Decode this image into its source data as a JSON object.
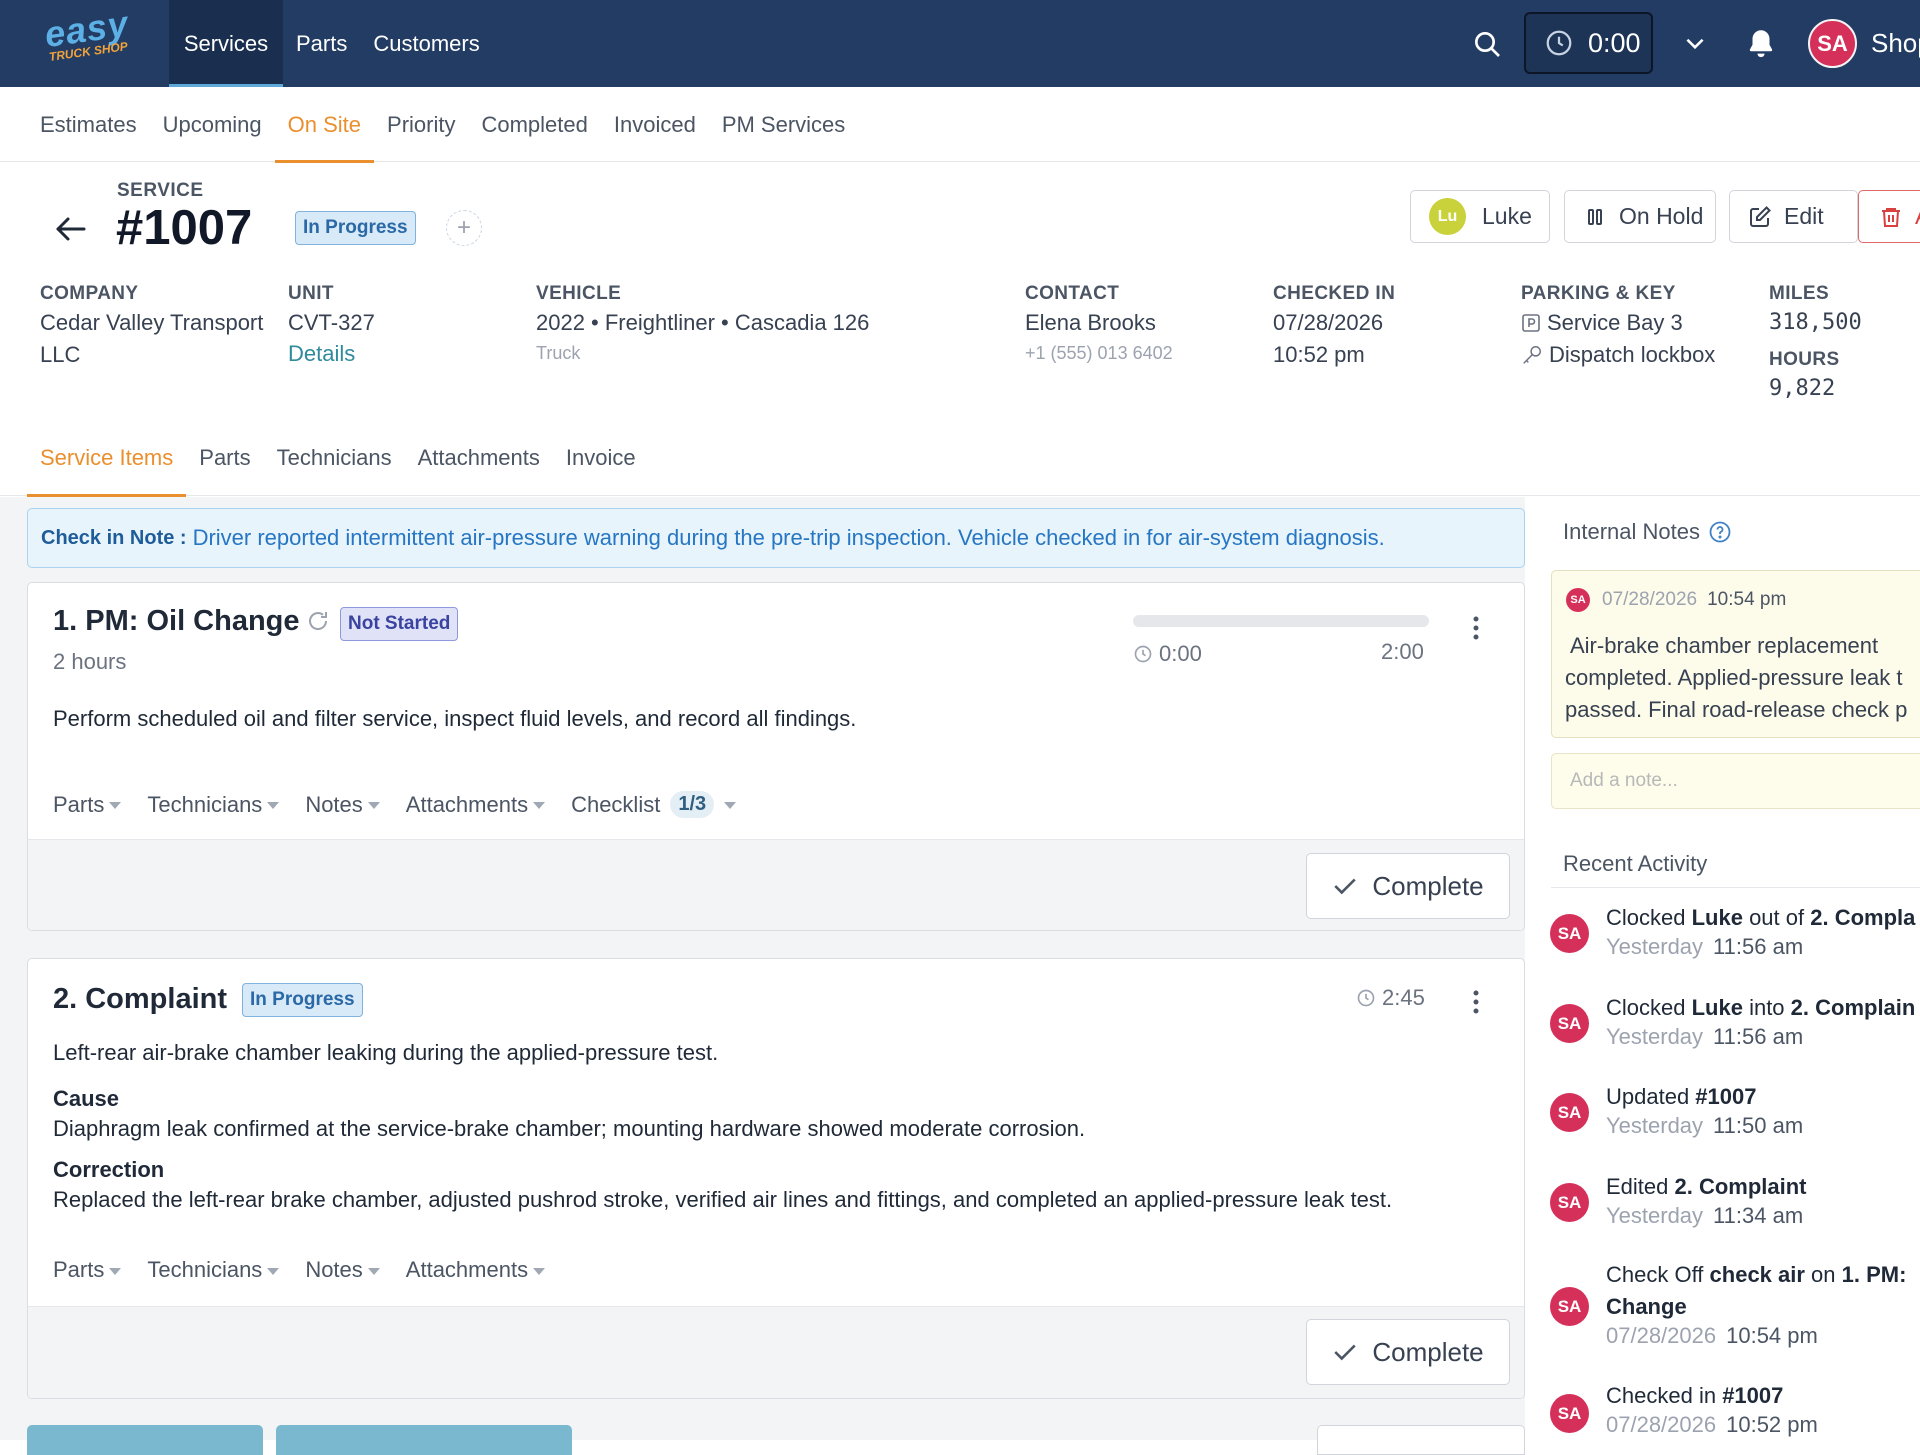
{
  "topnav": {
    "logo_top": "easy",
    "logo_bottom": "TRUCK SHOP",
    "items": [
      "Services",
      "Parts",
      "Customers"
    ],
    "timer": "0:00",
    "avatar": "SA",
    "shop_label": "Shop"
  },
  "subtabs": [
    "Estimates",
    "Upcoming",
    "On Site",
    "Priority",
    "Completed",
    "Invoiced",
    "PM Services"
  ],
  "service": {
    "label": "SERVICE",
    "number": "#1007",
    "status": "In Progress",
    "add": "+",
    "buttons": {
      "luke_initials": "Lu",
      "luke": "Luke",
      "hold": "On Hold",
      "edit": "Edit",
      "delete": "A"
    }
  },
  "info": {
    "company_label": "COMPANY",
    "company_line1": "Cedar Valley Transport",
    "company_line2": "LLC",
    "unit_label": "UNIT",
    "unit": "CVT-327",
    "unit_link": "Details",
    "vehicle_label": "VEHICLE",
    "vehicle": "2022 • Freightliner • Cascadia 126",
    "vehicle_type": "Truck",
    "contact_label": "CONTACT",
    "contact": "Elena Brooks",
    "contact_phone": "+1 (555) 013 6402",
    "checked_label": "CHECKED IN",
    "checked_date": "07/28/2026",
    "checked_time": "10:52 pm",
    "parking_label": "PARKING & KEY",
    "parking": "Service Bay 3",
    "key": "Dispatch lockbox",
    "miles_label": "MILES",
    "miles": "318,500",
    "hours_label": "HOURS",
    "hours": "9,822"
  },
  "content_tabs": [
    "Service Items",
    "Parts",
    "Technicians",
    "Attachments",
    "Invoice"
  ],
  "checkin_note": {
    "label": "Check in Note :",
    "text": "Driver reported intermittent air-pressure warning during the pre-trip inspection. Vehicle checked in for air-system diagnosis."
  },
  "items": [
    {
      "title": "1. PM: Oil Change",
      "status": "Not Started",
      "duration": "2 hours",
      "progress": 0,
      "time_spent": "0:00",
      "time_total": "2:00",
      "description": "Perform scheduled oil and filter service, inspect fluid levels, and record all findings.",
      "dropdowns": [
        "Parts",
        "Technicians",
        "Notes",
        "Attachments",
        "Checklist"
      ],
      "checklist_count": "1/3",
      "complete": "Complete"
    },
    {
      "title": "2. Complaint",
      "status": "In Progress",
      "time": "2:45",
      "description": "Left-rear air-brake chamber leaking during the applied-pressure test.",
      "cause_label": "Cause",
      "cause": "Diaphragm leak confirmed at the service-brake chamber; mounting hardware showed moderate corrosion.",
      "correction_label": "Correction",
      "correction": "Replaced the left-rear brake chamber, adjusted pushrod stroke, verified air lines and fittings, and completed an applied-pressure leak test.",
      "dropdowns": [
        "Parts",
        "Technicians",
        "Notes",
        "Attachments"
      ],
      "complete": "Complete"
    }
  ],
  "internal_notes": {
    "title": "Internal Notes",
    "note_avatar": "SA",
    "note_date": "07/28/2026",
    "note_time": "10:54 pm",
    "note_line1": "Air-brake chamber replacement",
    "note_line2": "completed. Applied-pressure leak t",
    "note_line3": "passed. Final road-release check p",
    "placeholder": "Add a note..."
  },
  "recent_activity": {
    "title": "Recent Activity",
    "entries": [
      {
        "avatar": "SA",
        "pre": "Clocked ",
        "b1": "Luke",
        "mid": " out of ",
        "b2": "2. Compla",
        "day": "Yesterday",
        "time": "11:56 am"
      },
      {
        "avatar": "SA",
        "pre": "Clocked ",
        "b1": "Luke",
        "mid": " into ",
        "b2": "2. Complain",
        "day": "Yesterday",
        "time": "11:56 am"
      },
      {
        "avatar": "SA",
        "pre": "Updated ",
        "b1": "#1007",
        "mid": "",
        "b2": "",
        "day": "Yesterday",
        "time": "11:50 am"
      },
      {
        "avatar": "SA",
        "pre": "Edited ",
        "b1": "2. Complaint",
        "mid": "",
        "b2": "",
        "day": "Yesterday",
        "time": "11:34 am"
      },
      {
        "avatar": "SA",
        "pre": "Check Off ",
        "b1": "check air",
        "mid": " on ",
        "b2": "1. PM: ",
        "b3": "Change",
        "day": "07/28/2026",
        "time": "10:54 pm"
      },
      {
        "avatar": "SA",
        "pre": "Checked in ",
        "b1": "#1007",
        "mid": "",
        "b2": "",
        "day": "07/28/2026",
        "time": "10:52 pm"
      }
    ]
  }
}
